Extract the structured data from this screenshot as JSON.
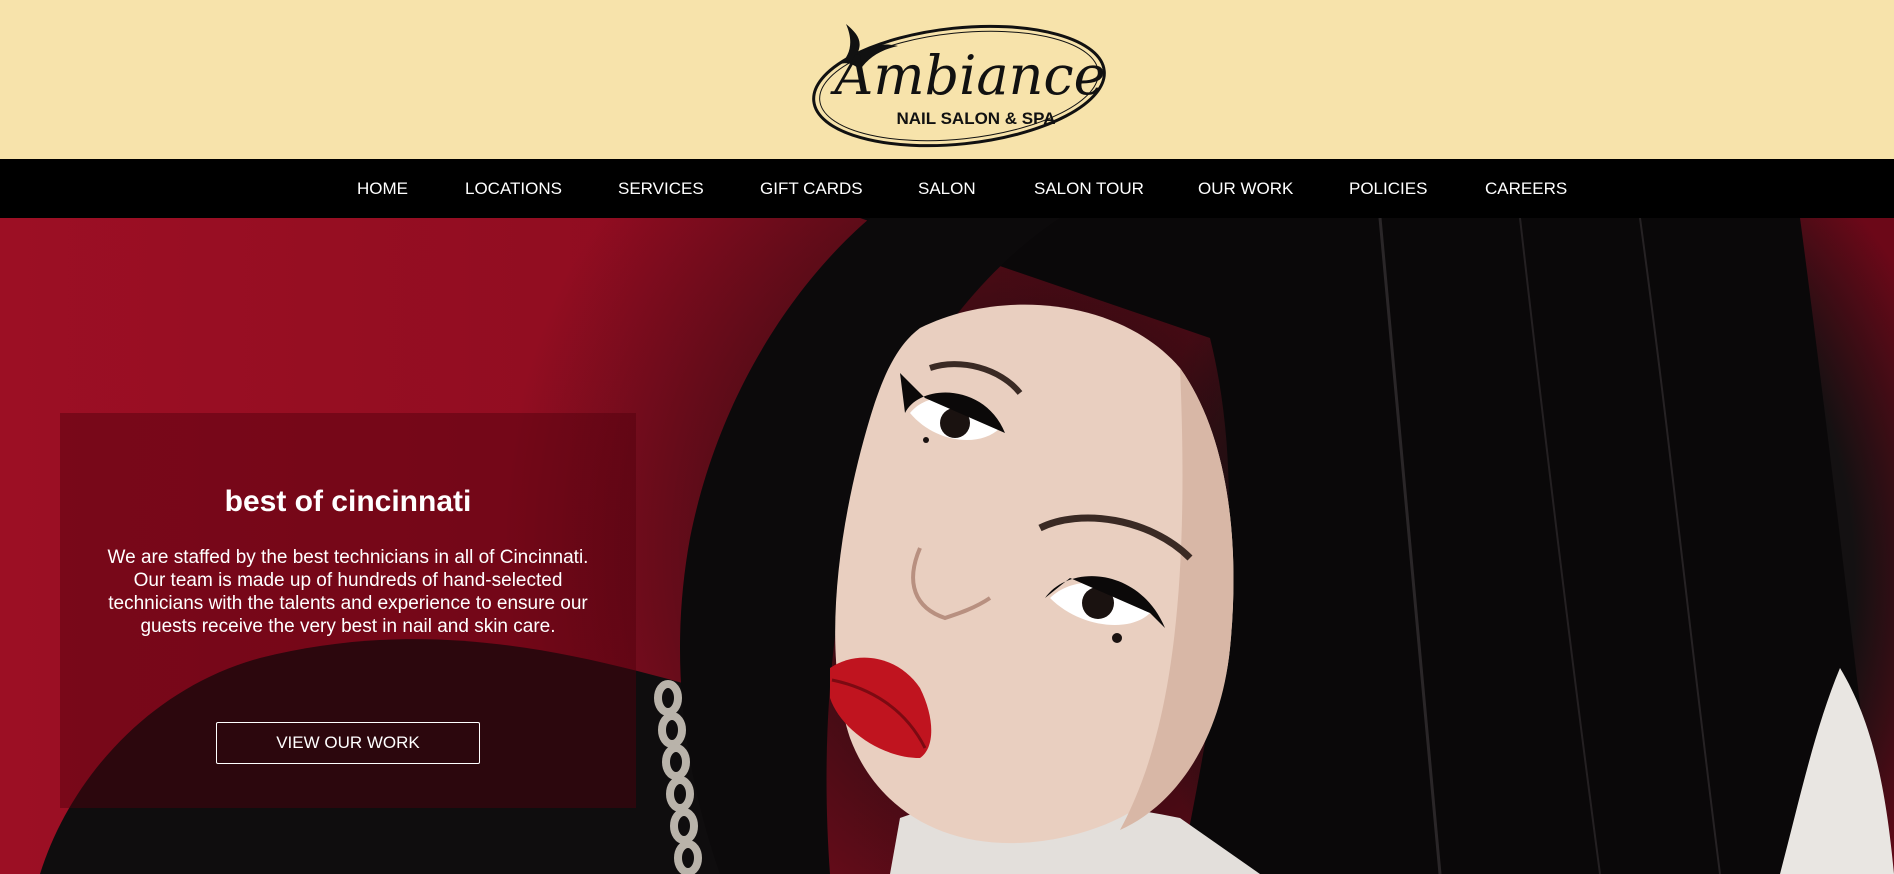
{
  "logo": {
    "script_text": "Ambiance",
    "tagline": "NAIL SALON & SPA"
  },
  "nav": {
    "items": [
      {
        "label": "HOME"
      },
      {
        "label": "LOCATIONS"
      },
      {
        "label": "SERVICES"
      },
      {
        "label": "GIFT CARDS"
      },
      {
        "label": "SALON"
      },
      {
        "label": "SALON TOUR"
      },
      {
        "label": "OUR WORK"
      },
      {
        "label": "POLICIES"
      },
      {
        "label": "CAREERS"
      }
    ]
  },
  "hero": {
    "title": "best of cincinnati",
    "body": "We are staffed by the best technicians in all of Cincinnati. Our team is made up of hundreds of hand-selected technicians with the talents and experience to ensure our guests receive the very best in nail and skin care.",
    "button_label": "VIEW OUR WORK"
  },
  "colors": {
    "header_bg": "#f7e3ab",
    "nav_bg": "#000000",
    "hero_red": "#8e0c20",
    "lip_red": "#c0141f"
  }
}
